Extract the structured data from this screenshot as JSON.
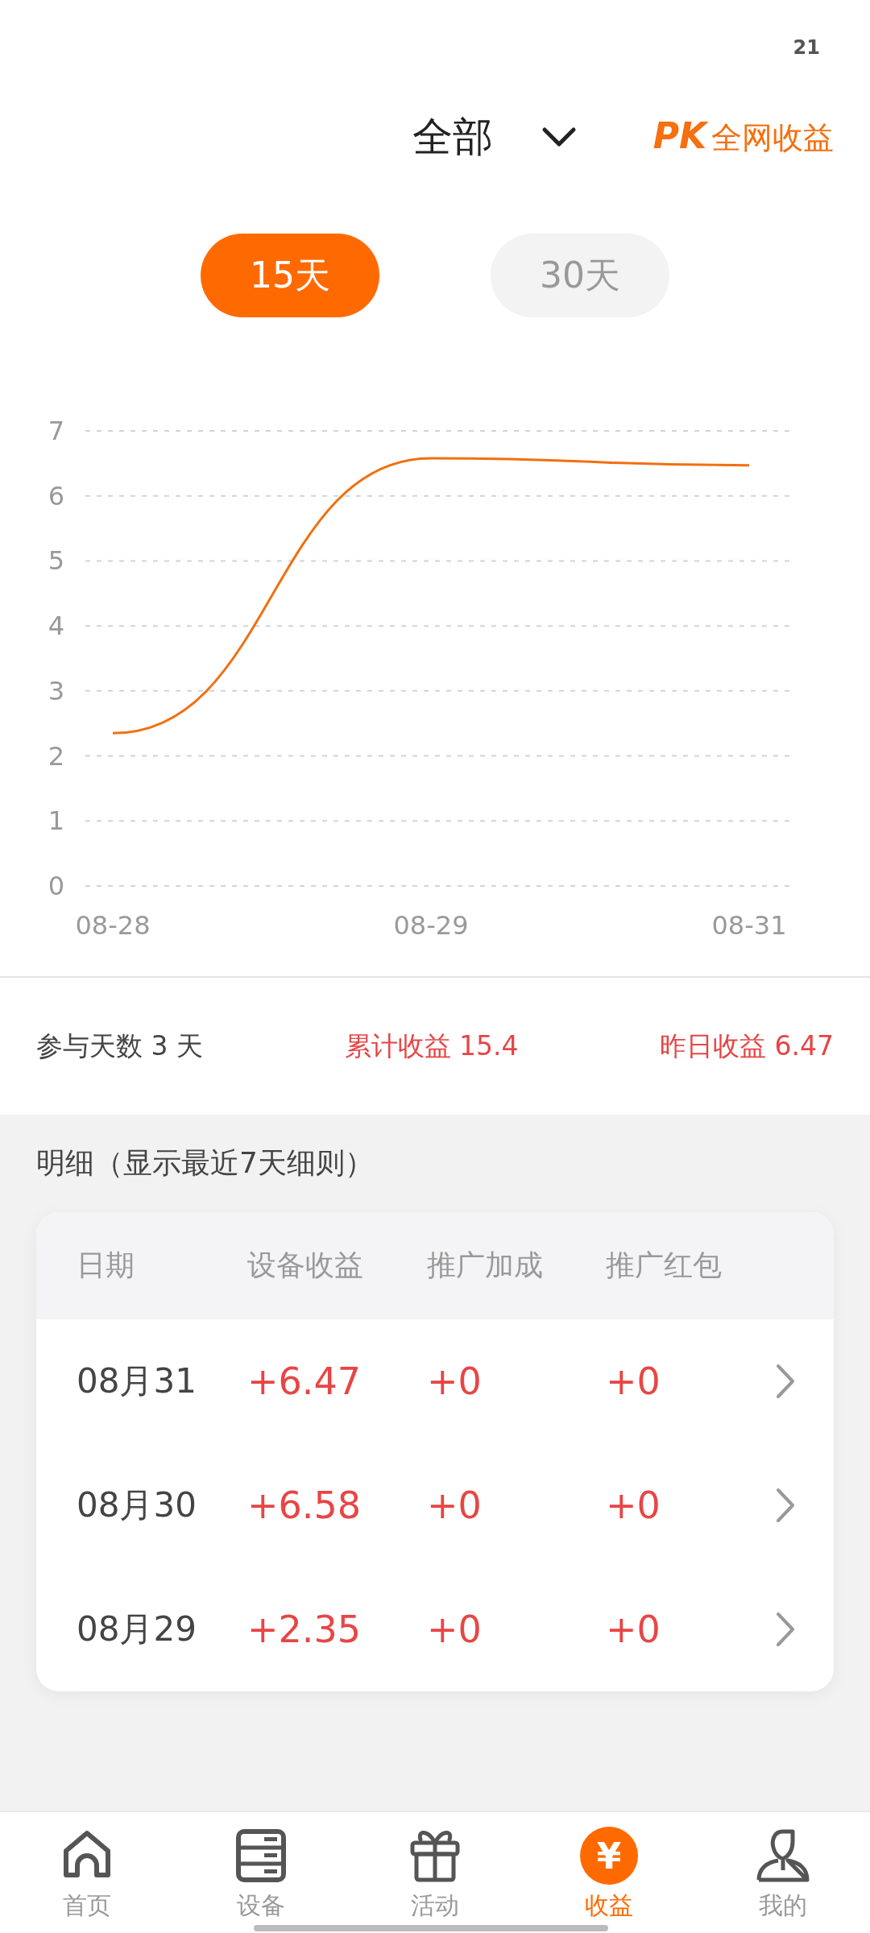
{
  "status_bar": {
    "time": "21"
  },
  "header": {
    "filter": "全部",
    "pk_badge": "PK",
    "pk_label": "全网收益"
  },
  "period_tabs": [
    {
      "label": "15天",
      "selected": true
    },
    {
      "label": "30天",
      "selected": false
    }
  ],
  "chart_data": {
    "type": "line",
    "categories": [
      "08-28",
      "08-29",
      "08-31"
    ],
    "series": [
      {
        "color": "#f07010",
        "values": [
          2.35,
          6.58,
          6.47
        ]
      }
    ],
    "ylim": [
      0,
      7
    ],
    "grid": true,
    "yticks": [
      0,
      1,
      2,
      3,
      4,
      5,
      6,
      7
    ]
  },
  "summary": {
    "days": "参与天数 3 天",
    "total": "累计收益 15.4",
    "yesterday": "昨日收益 6.47"
  },
  "details": {
    "title": "明细（显示最近7天细则）",
    "columns": [
      "日期",
      "设备收益",
      "推广加成",
      "推广红包"
    ],
    "rows": [
      {
        "date": "08月31",
        "device": "+6.47",
        "promo": "+0",
        "bonus": "+0"
      },
      {
        "date": "08月30",
        "device": "+6.58",
        "promo": "+0",
        "bonus": "+0"
      },
      {
        "date": "08月29",
        "device": "+2.35",
        "promo": "+0",
        "bonus": "+0"
      }
    ]
  },
  "nav": [
    {
      "kind": "home",
      "label": "首页",
      "selected": false
    },
    {
      "kind": "device",
      "label": "设备",
      "selected": false
    },
    {
      "kind": "gift",
      "label": "活动",
      "selected": false
    },
    {
      "kind": "earnings",
      "label": "收益",
      "icon_char": "¥",
      "selected": true
    },
    {
      "kind": "profile",
      "label": "我的",
      "selected": false
    }
  ]
}
